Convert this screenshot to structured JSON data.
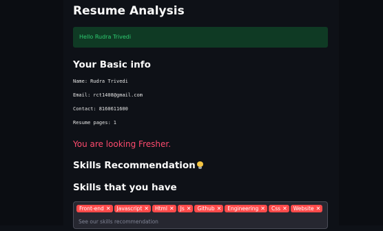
{
  "app": {
    "title": "Resume Analysis"
  },
  "greeting": {
    "text": "Hello Rudra Trivedi",
    "color": "#2ecc71"
  },
  "basic_info": {
    "heading": "Your Basic info",
    "name": {
      "label": "Name:",
      "value": "Rudra Trivedi"
    },
    "email": {
      "label": "Email:",
      "value": "rct1408@gmail.com"
    },
    "contact": {
      "label": "Contact:",
      "value": "8160611600"
    },
    "pages": {
      "label": "Resume pages:",
      "value": "1"
    }
  },
  "level": {
    "text": "You are looking Fresher.",
    "color": "#ff4b6e"
  },
  "recommendation": {
    "heading": "Skills Recommendation",
    "icon": "lightbulb-icon"
  },
  "skills": {
    "heading": "Skills that you have",
    "tags": [
      "Front-end",
      "Javascript",
      "Html",
      "Js",
      "Github",
      "Engineering",
      "Css",
      "Website"
    ],
    "remove_icon": "✕",
    "placeholder": "See our skills recommendation",
    "tag_color": "#ff4b4b"
  }
}
